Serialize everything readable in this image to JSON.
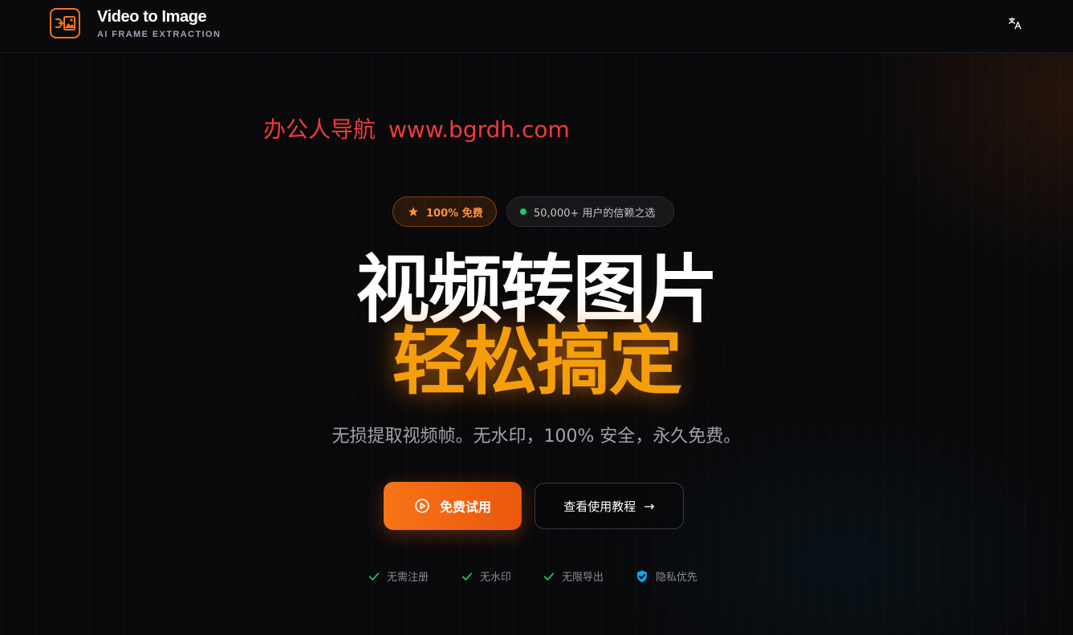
{
  "header": {
    "brand_title": "Video to Image",
    "brand_subtitle": "AI FRAME EXTRACTION",
    "logo_icon": "video-to-image-logo-icon",
    "translate_icon": "translate-icon"
  },
  "watermark": {
    "text": "办公人导航",
    "url": "www.bgrdh.com"
  },
  "badges": {
    "free": "100% 免费",
    "trust": "50,000+ 用户的信赖之选"
  },
  "hero": {
    "title": "视频转图片",
    "highlight": "轻松搞定",
    "subtitle": "无损提取视频帧。无水印，100% 安全，永久免费。"
  },
  "buttons": {
    "primary": "免费试用",
    "secondary": "查看使用教程",
    "secondary_arrow": "→"
  },
  "features": [
    {
      "label": "无需注册",
      "icon": "check-icon"
    },
    {
      "label": "无水印",
      "icon": "check-icon"
    },
    {
      "label": "无限导出",
      "icon": "check-icon"
    },
    {
      "label": "隐私优先",
      "icon": "shield-check-icon"
    }
  ],
  "colors": {
    "accent": "#f97316",
    "highlight": "#f59e0b",
    "watermark": "#ef3b3b",
    "check": "#22c55e",
    "shield": "#0ea5e9",
    "background": "#09090b"
  }
}
